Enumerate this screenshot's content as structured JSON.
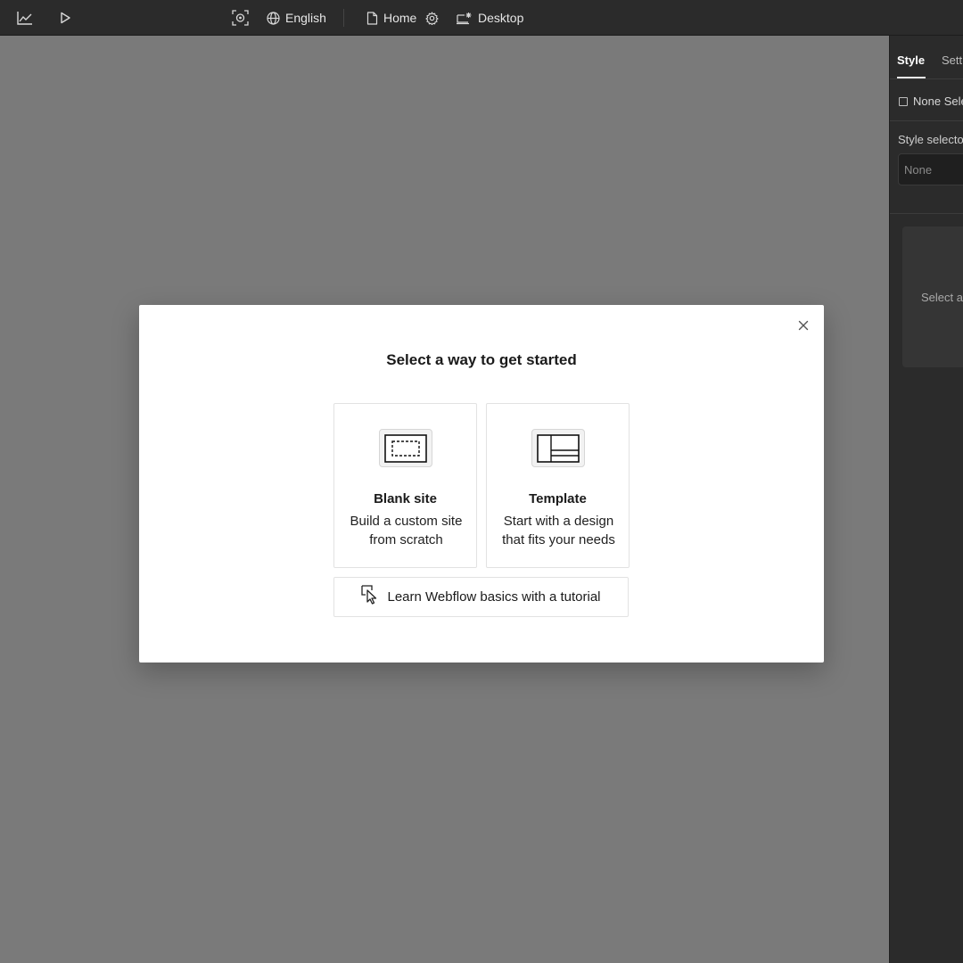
{
  "topbar": {
    "analytics_icon": "line-chart-icon",
    "preview_icon": "play-icon",
    "focus_icon": "focus-target-icon",
    "locale_icon": "globe-icon",
    "locale_label": "English",
    "page_icon": "page-icon",
    "page_label": "Home",
    "page_settings_icon": "gear-icon",
    "breakpoint_icon": "desktop-breakpoint-icon",
    "breakpoint_label": "Desktop"
  },
  "panel": {
    "tabs": [
      {
        "label": "Style",
        "active": true
      },
      {
        "label": "Settings",
        "active": false
      }
    ],
    "selection_label": "None Selected",
    "style_selector_label": "Style selector",
    "style_selector_value": "None",
    "empty_state_text": "Select an element"
  },
  "modal": {
    "title": "Select a way to get started",
    "close_icon": "close-icon",
    "options": [
      {
        "title": "Blank site",
        "description": "Build a custom site from scratch",
        "icon": "blank-canvas-icon"
      },
      {
        "title": "Template",
        "description": "Start with a design that fits your needs",
        "icon": "template-layout-icon"
      }
    ],
    "tutorial": {
      "label": "Learn Webflow basics with a tutorial",
      "icon": "cursor-click-icon"
    }
  },
  "colors": {
    "topbar_bg": "#2b2b2b",
    "canvas_bg": "#7a7a7a",
    "panel_bg": "#2b2b2b",
    "modal_bg": "#ffffff",
    "text_dark": "#1a1a1a",
    "text_light": "#e6e6e6"
  }
}
